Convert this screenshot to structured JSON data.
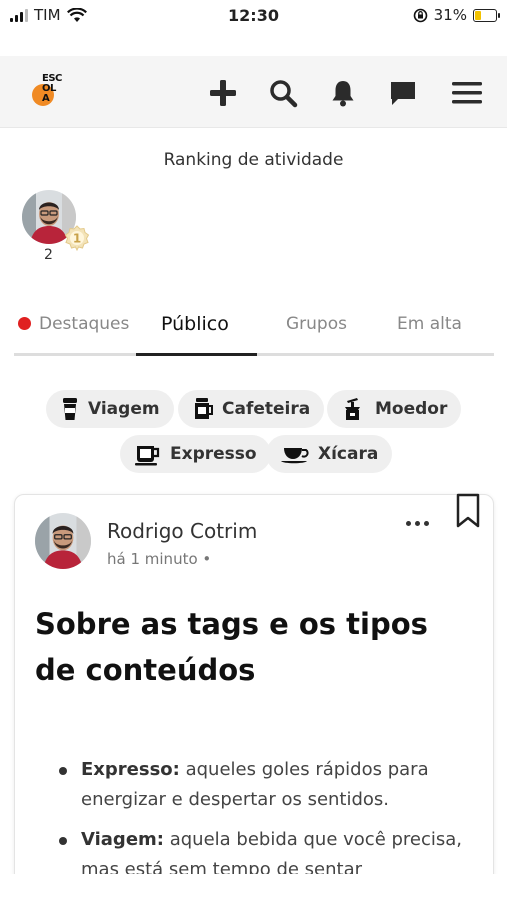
{
  "status_bar": {
    "carrier": "TIM",
    "time": "12:30",
    "battery": "31%",
    "battery_level": 0.31
  },
  "header": {
    "logo": "ESCOLA",
    "icons": [
      "plus-icon",
      "search-icon",
      "bell-icon",
      "chat-icon",
      "menu-icon"
    ]
  },
  "ranking": {
    "title": "Ranking de atividade",
    "entries": [
      {
        "position": "2",
        "medal": "1"
      }
    ]
  },
  "tabs": [
    {
      "label": "Destaques"
    },
    {
      "label": "Público"
    },
    {
      "label": "Grupos"
    },
    {
      "label": "Em alta"
    }
  ],
  "tags": [
    {
      "label": "Viagem",
      "icon": "travel-cup-icon"
    },
    {
      "label": "Cafeteira",
      "icon": "coffee-maker-icon"
    },
    {
      "label": "Moedor",
      "icon": "grinder-icon"
    },
    {
      "label": "Expresso",
      "icon": "espresso-cup-icon"
    },
    {
      "label": "Xícara",
      "icon": "teacup-icon"
    }
  ],
  "post": {
    "author": "Rodrigo Cotrim",
    "time": "há 1 minuto •",
    "title": "Sobre as tags e os tipos de conteúdos",
    "items": [
      {
        "term": "Expresso:",
        "text": " aqueles goles rápidos para energizar e despertar os sentidos."
      },
      {
        "term": "Viagem:",
        "text": " aquela bebida que você precisa, mas está sem tempo de sentar"
      }
    ]
  },
  "colors": {
    "accent_red": "#e02020",
    "logo_orange": "#f08a24",
    "chip_bg": "#efefef"
  }
}
